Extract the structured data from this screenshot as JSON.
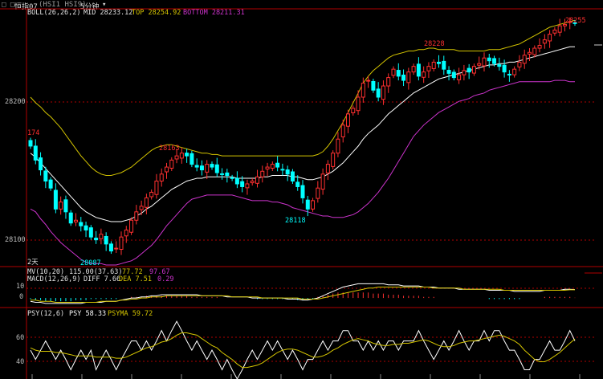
{
  "title_bar": {
    "window_icons": "□ □",
    "symbol_name": "恒指07",
    "symbol_code": "(HSI1 HSI9)",
    "timeframe": "5分钟",
    "dropdown_icon": "chevron-down-icon"
  },
  "panel_main": {
    "indicator_name": "BOLL(26,26,2)",
    "mid_label": "MID 28233.12",
    "top_label": "TOP 28254.92",
    "bottom_label": "BOTTOM 28211.31",
    "y_labels": [
      "28200",
      "28100"
    ],
    "annotations": {
      "start_label": "174",
      "high_1": "28163",
      "low_1": "28087",
      "high_2": "28228",
      "low_2": "28118",
      "high_3": "28255",
      "day_marker": "2天"
    }
  },
  "panel_macd": {
    "vol_label": "MV(10,20)",
    "vol_values": "115.00(37.63)",
    "vol_v1": "77.72",
    "vol_v2": "97.67",
    "indicator_name": "MACD(12,26,9)",
    "diff_label": "DIFF 7.66",
    "dea_label": "DEA 7.51",
    "macd_label": "0.29",
    "y_labels": [
      "10",
      "0"
    ]
  },
  "panel_psy": {
    "indicator_name": "PSY(12,6)",
    "psy_label": "PSY 58.33",
    "psyma_label": "PSYMA 59.72",
    "y_labels": [
      "60",
      "40"
    ]
  },
  "colors": {
    "up": "#ff3030",
    "down": "#00ffff",
    "mid": "#ffffff",
    "top": "#d4c400",
    "bottom": "#cc33cc",
    "border": "#b00000",
    "psy": "#ffffff",
    "psyma": "#d4c400"
  },
  "chart_data": [
    {
      "type": "candlestick",
      "title": "BOLL(26,26,2)",
      "ylim": [
        28080,
        28262
      ],
      "labeled_points": [
        {
          "label": "174",
          "value": 28174
        },
        {
          "label": "28163",
          "value": 28163
        },
        {
          "label": "28087",
          "value": 28087
        },
        {
          "label": "28228",
          "value": 28228
        },
        {
          "label": "28118",
          "value": 28118
        },
        {
          "label": "28255",
          "value": 28255
        }
      ],
      "close": [
        28165,
        28155,
        28148,
        28140,
        28135,
        28120,
        28125,
        28118,
        28110,
        28112,
        28108,
        28105,
        28100,
        28098,
        28102,
        28095,
        28090,
        28092,
        28100,
        28105,
        28112,
        28118,
        28122,
        28128,
        28132,
        28140,
        28145,
        28150,
        28155,
        28158,
        28160,
        28158,
        28152,
        28150,
        28148,
        28152,
        28150,
        28146,
        28145,
        28144,
        28142,
        28138,
        28136,
        28138,
        28140,
        28143,
        28147,
        28150,
        28152,
        28150,
        28148,
        28145,
        28140,
        28136,
        28128,
        28120,
        28126,
        28135,
        28145,
        28152,
        28160,
        28170,
        28180,
        28188,
        28192,
        28200,
        28210,
        28212,
        28205,
        28200,
        28208,
        28214,
        28220,
        28215,
        28212,
        28218,
        28222,
        28215,
        28218,
        28222,
        28225,
        28224,
        28220,
        28217,
        28214,
        28216,
        28219,
        28218,
        28222,
        28224,
        28228,
        28226,
        28224,
        28222,
        28218,
        28216,
        28220,
        28225,
        28230,
        28232,
        28235,
        28237,
        28241,
        28245,
        28248,
        28251,
        28252,
        28254,
        28253
      ],
      "series": [
        {
          "name": "MID",
          "values": [
            28160,
            28157,
            28153,
            28149,
            28145,
            28141,
            28137,
            28133,
            28129,
            28125,
            28121,
            28118,
            28116,
            28114,
            28113,
            28112,
            28111,
            28111,
            28111,
            28112,
            28113,
            28115,
            28117,
            28120,
            28122,
            28125,
            28128,
            28131,
            28134,
            28136,
            28138,
            28140,
            28141,
            28142,
            28142,
            28143,
            28143,
            28143,
            28143,
            28143,
            28143,
            28142,
            28142,
            28142,
            28142,
            28142,
            28143,
            28143,
            28144,
            28144,
            28144,
            28144,
            28143,
            28143,
            28142,
            28141,
            28141,
            28142,
            28143,
            28145,
            28147,
            28150,
            28153,
            28157,
            28161,
            28165,
            28170,
            28174,
            28177,
            28180,
            28184,
            28188,
            28191,
            28194,
            28197,
            28200,
            28203,
            28205,
            28207,
            28209,
            28211,
            28213,
            28214,
            28215,
            28216,
            28217,
            28218,
            28219,
            28220,
            28221,
            28222,
            28223,
            28223,
            28224,
            28224,
            28225,
            28225,
            28226,
            28227,
            28228,
            28229,
            28230,
            28231,
            28232,
            28233,
            28234,
            28235,
            28236,
            28236
          ]
        },
        {
          "name": "TOP",
          "values": [
            28200,
            28196,
            28193,
            28189,
            28186,
            28182,
            28178,
            28173,
            28168,
            28163,
            28158,
            28154,
            28150,
            28147,
            28145,
            28144,
            28144,
            28145,
            28146,
            28148,
            28150,
            28153,
            28156,
            28159,
            28162,
            28164,
            28165,
            28166,
            28166,
            28165,
            28164,
            28163,
            28162,
            28161,
            28160,
            28160,
            28159,
            28159,
            28158,
            28158,
            28158,
            28158,
            28158,
            28158,
            28158,
            28158,
            28158,
            28158,
            28158,
            28158,
            28158,
            28158,
            28158,
            28158,
            28158,
            28158,
            28158,
            28159,
            28161,
            28165,
            28170,
            28176,
            28182,
            28189,
            28196,
            28203,
            28210,
            28215,
            28219,
            28222,
            28225,
            28228,
            28230,
            28231,
            28232,
            28233,
            28233,
            28234,
            28234,
            28235,
            28235,
            28234,
            28234,
            28234,
            28234,
            28233,
            28233,
            28233,
            28233,
            28233,
            28233,
            28234,
            28234,
            28234,
            28235,
            28236,
            28237,
            28238,
            28240,
            28242,
            28244,
            28246,
            28248,
            28250,
            28251,
            28252,
            28253,
            28254,
            28255
          ]
        },
        {
          "name": "BOTTOM",
          "values": [
            28120,
            28118,
            28113,
            28109,
            28104,
            28100,
            28096,
            28093,
            28090,
            28087,
            28084,
            28082,
            28081,
            28081,
            28081,
            28080,
            28080,
            28080,
            28081,
            28082,
            28083,
            28085,
            28088,
            28091,
            28094,
            28098,
            28103,
            28108,
            28112,
            28116,
            28120,
            28124,
            28127,
            28128,
            28129,
            28130,
            28130,
            28130,
            28130,
            28130,
            28130,
            28129,
            28128,
            28127,
            28126,
            28126,
            28126,
            28126,
            28125,
            28125,
            28124,
            28123,
            28121,
            28120,
            28119,
            28118,
            28117,
            28116,
            28115,
            28115,
            28114,
            28114,
            28114,
            28115,
            28116,
            28118,
            28121,
            28124,
            28128,
            28132,
            28137,
            28142,
            28148,
            28154,
            28160,
            28166,
            28172,
            28176,
            28180,
            28183,
            28186,
            28189,
            28191,
            28193,
            28195,
            28197,
            28198,
            28199,
            28201,
            28202,
            28203,
            28205,
            28206,
            28207,
            28208,
            28209,
            28210,
            28211,
            28211,
            28211,
            28211,
            28211,
            28211,
            28211,
            28212,
            28212,
            28212,
            28211,
            28211
          ]
        }
      ]
    },
    {
      "type": "bar",
      "title": "MACD(12,26,9)",
      "ylim": [
        -8,
        14
      ],
      "series": [
        {
          "name": "MACD",
          "values": [
            -1,
            -2,
            -2,
            -3,
            -3,
            -3,
            -3,
            -3,
            -3,
            -2,
            -2,
            -2,
            -1,
            -1,
            -1,
            -1,
            -1,
            -1,
            0,
            0,
            1,
            1,
            1,
            2,
            2,
            2,
            2,
            2,
            2,
            2,
            2,
            2,
            1,
            1,
            1,
            1,
            1,
            1,
            0,
            0,
            0,
            0,
            0,
            0,
            0,
            -1,
            -1,
            -1,
            -1,
            -1,
            -1,
            -1,
            -1,
            -2,
            -2,
            -1,
            -1,
            1,
            2,
            3,
            4,
            5,
            5,
            5,
            5,
            5,
            5,
            5,
            4,
            4,
            4,
            3,
            3,
            3,
            2,
            2,
            2,
            2,
            1,
            1,
            1,
            0,
            0,
            0,
            0,
            0,
            0,
            0,
            0,
            0,
            0,
            -1,
            -1,
            -1,
            -1,
            -1,
            -1,
            -1,
            0,
            0,
            0,
            0,
            1,
            1,
            1,
            1,
            1,
            1,
            0.29
          ]
        },
        {
          "name": "DIFF",
          "values": [
            -3,
            -4,
            -4,
            -5,
            -5,
            -5,
            -5,
            -5,
            -5,
            -5,
            -5,
            -4,
            -4,
            -4,
            -4,
            -3,
            -3,
            -3,
            -2,
            -1,
            0,
            0,
            1,
            1,
            2,
            2,
            3,
            3,
            3,
            3,
            3,
            3,
            3,
            3,
            2,
            2,
            2,
            2,
            2,
            1,
            1,
            1,
            1,
            1,
            0,
            0,
            0,
            0,
            0,
            0,
            0,
            -1,
            -1,
            -1,
            -2,
            -2,
            -1,
            0,
            2,
            4,
            6,
            8,
            10,
            11,
            12,
            13,
            13,
            13,
            13,
            13,
            13,
            12,
            12,
            12,
            11,
            11,
            11,
            11,
            10,
            10,
            10,
            9,
            9,
            9,
            9,
            8,
            8,
            8,
            8,
            8,
            8,
            7,
            7,
            7,
            7,
            7,
            6,
            6,
            6,
            6,
            6,
            6,
            7,
            7,
            7,
            7,
            8,
            8,
            7.66
          ]
        },
        {
          "name": "DEA",
          "values": [
            -2,
            -2,
            -3,
            -3,
            -3,
            -4,
            -4,
            -4,
            -4,
            -4,
            -4,
            -4,
            -4,
            -4,
            -3,
            -3,
            -3,
            -3,
            -2,
            -2,
            -1,
            -1,
            0,
            0,
            1,
            1,
            1,
            2,
            2,
            2,
            2,
            2,
            2,
            2,
            2,
            2,
            2,
            2,
            2,
            2,
            1,
            1,
            1,
            1,
            1,
            1,
            0,
            0,
            0,
            0,
            0,
            0,
            0,
            0,
            -1,
            -1,
            -1,
            -1,
            0,
            1,
            2,
            3,
            4,
            5,
            6,
            7,
            8,
            9,
            9,
            10,
            10,
            10,
            10,
            10,
            10,
            10,
            10,
            10,
            10,
            10,
            9,
            9,
            9,
            9,
            9,
            9,
            8,
            8,
            8,
            8,
            8,
            8,
            8,
            8,
            7,
            7,
            7,
            7,
            7,
            7,
            7,
            7,
            7,
            7,
            7,
            7,
            7,
            7.5,
            7.51
          ]
        }
      ]
    },
    {
      "type": "line",
      "title": "PSY(12,6)",
      "ylim": [
        25,
        80
      ],
      "series": [
        {
          "name": "PSY",
          "values": [
            50,
            42,
            50,
            58,
            50,
            42,
            50,
            42,
            33,
            42,
            50,
            42,
            50,
            33,
            42,
            50,
            42,
            33,
            42,
            50,
            58,
            58,
            50,
            58,
            50,
            58,
            67,
            58,
            67,
            75,
            67,
            58,
            50,
            58,
            50,
            42,
            50,
            42,
            33,
            42,
            33,
            25,
            33,
            42,
            50,
            42,
            50,
            58,
            50,
            58,
            50,
            42,
            50,
            42,
            33,
            42,
            42,
            50,
            58,
            50,
            58,
            58,
            67,
            67,
            58,
            58,
            50,
            58,
            50,
            58,
            50,
            58,
            58,
            50,
            58,
            58,
            58,
            67,
            58,
            50,
            42,
            50,
            58,
            50,
            58,
            67,
            58,
            50,
            58,
            58,
            67,
            58,
            67,
            67,
            58,
            50,
            50,
            42,
            33,
            33,
            42,
            42,
            50,
            58,
            50,
            50,
            58,
            67,
            58
          ]
        },
        {
          "name": "PSYMA",
          "values": [
            52,
            50,
            49,
            49,
            49,
            48,
            48,
            47,
            46,
            45,
            45,
            45,
            45,
            44,
            44,
            44,
            44,
            43,
            43,
            44,
            46,
            48,
            50,
            52,
            53,
            55,
            57,
            58,
            60,
            63,
            65,
            65,
            64,
            63,
            60,
            57,
            54,
            52,
            48,
            45,
            42,
            38,
            35,
            35,
            36,
            37,
            39,
            42,
            45,
            48,
            50,
            51,
            51,
            50,
            48,
            46,
            44,
            44,
            45,
            47,
            50,
            52,
            55,
            57,
            59,
            60,
            59,
            58,
            56,
            55,
            54,
            54,
            55,
            55,
            56,
            56,
            57,
            58,
            59,
            58,
            56,
            54,
            53,
            53,
            54,
            56,
            57,
            58,
            58,
            59,
            60,
            61,
            62,
            63,
            62,
            60,
            58,
            55,
            50,
            46,
            42,
            40,
            40,
            42,
            45,
            48,
            52,
            56,
            59.72
          ]
        }
      ]
    }
  ]
}
